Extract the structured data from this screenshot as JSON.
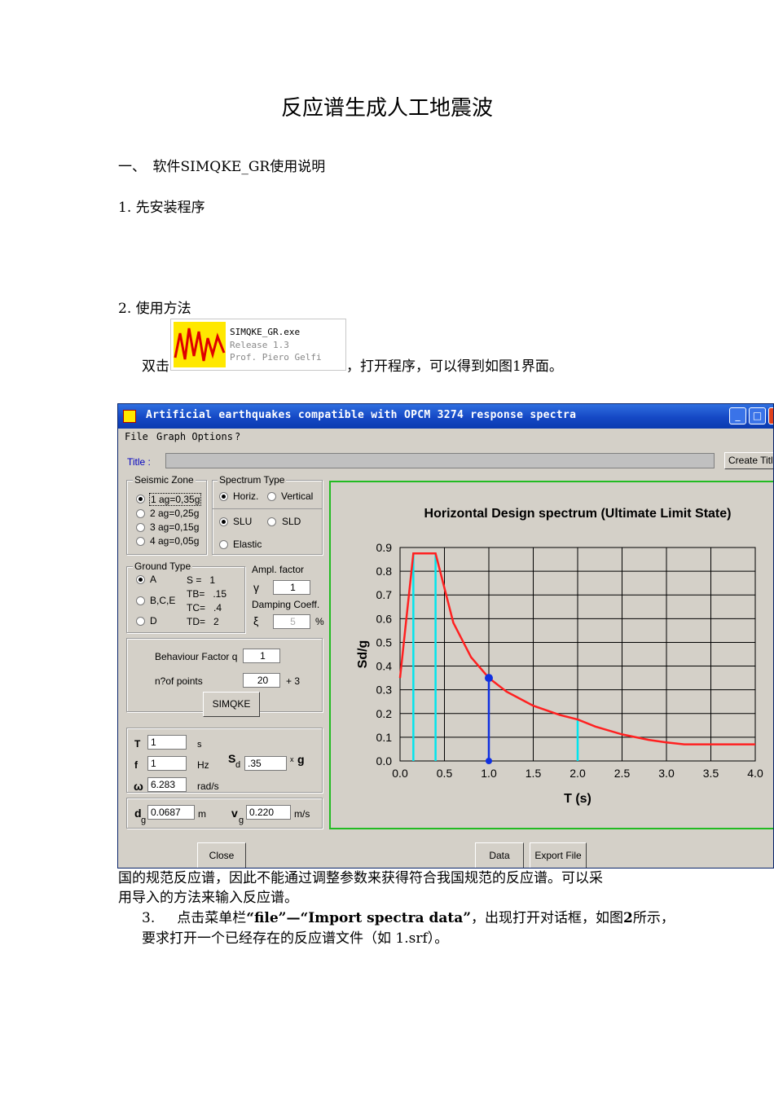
{
  "document": {
    "title": "反应谱生成人工地震波",
    "section1": "一、　软件SIMQKE_GR使用说明",
    "step1": "1. 先安装程序",
    "step2": "2. 使用方法",
    "dblclick": "双击",
    "after_icon": "，打开程序，可以得到如图1界面。",
    "exe_name": "SIMQKE_GR.exe",
    "exe_release": "Release 1.3",
    "exe_author": "Prof. Piero Gelfi",
    "para_line1": "国的规范反应谱，因此不能通过调整参数来获得符合我国规范的反应谱。可以采",
    "para_line2": "用导入的方法来输入反应谱。",
    "step3_num": "3.",
    "step3_a": "点击菜单栏",
    "step3_b": "“file”—“Import spectra data”",
    "step3_c": "，出现打开对话框，如图",
    "step3_d": "2",
    "step3_e": "所示，",
    "step3_line2": "要求打开一个已经存在的反应谱文件（如 1.srf）。"
  },
  "app": {
    "window_title": "Artificial earthquakes compatible with OPCM 3274 response spectra",
    "menu": [
      "File",
      "Graph Options",
      "?"
    ],
    "title_label": "Title :",
    "create_title_button": "Create Title",
    "seismic_zone": {
      "label": "Seismic Zone",
      "options": [
        "1 ag=0,35g",
        "2 ag=0,25g",
        "3 ag=0,15g",
        "4 ag=0,05g"
      ],
      "selected": 0
    },
    "spectrum_type": {
      "label": "Spectrum Type",
      "horiz": "Horiz.",
      "vertical": "Vertical",
      "slu": "SLU",
      "sld": "SLD",
      "elastic": "Elastic"
    },
    "ground_type": {
      "label": "Ground Type",
      "options": [
        "A",
        "B,C,E",
        "D"
      ],
      "s": "S =   1",
      "tb": "TB=   .15",
      "tc": "TC=   .4",
      "td": "TD=   2"
    },
    "ampl_factor_label": "Ampl. factor",
    "gamma": "γ",
    "ampl_factor_value": "1",
    "damping_label": "Damping Coeff.",
    "xi": "ξ",
    "damping_value": "5",
    "percent": "%",
    "behaviour_label": "Behaviour Factor q",
    "behaviour_value": "1",
    "npoints_label": "n?of points",
    "npoints_value": "20",
    "plus3": "+ 3",
    "simqke_button": "SIMQKE",
    "T_label": "T",
    "T_value": "1",
    "T_unit": "s",
    "f_label": "f",
    "f_value": "1",
    "f_unit": "Hz",
    "omega_label": "ω",
    "omega_value": "6.283",
    "omega_unit": "rad/s",
    "sd_label": "S",
    "sd_sub": "d",
    "sd_value": ".35",
    "sd_times": "x",
    "sd_g": "g",
    "dg_label": "d",
    "dg_sub": "g",
    "dg_value": "0.0687",
    "dg_unit": "m",
    "vg_label": "v",
    "vg_sub": "g",
    "vg_value": "0.220",
    "vg_unit": "m/s",
    "close_button": "Close",
    "data_button": "Data",
    "export_button": "Export File"
  },
  "chart_data": {
    "type": "line",
    "title": "Horizontal Design spectrum (Ultimate Limit State)",
    "xlabel": "T (s)",
    "ylabel": "Sd/g",
    "xlim": [
      0,
      4
    ],
    "ylim": [
      0,
      0.9
    ],
    "x_ticks": [
      "0.0",
      "0.5",
      "1.0",
      "1.5",
      "2.0",
      "2.5",
      "3.0",
      "3.5",
      "4.0"
    ],
    "y_ticks": [
      "0.0",
      "0.1",
      "0.2",
      "0.3",
      "0.4",
      "0.5",
      "0.6",
      "0.7",
      "0.8",
      "0.9"
    ],
    "grid": true,
    "series": [
      {
        "color": "#ff2020",
        "x": [
          0,
          0.15,
          0.4,
          0.6,
          0.8,
          1.0,
          1.2,
          1.5,
          1.8,
          2.0,
          2.2,
          2.5,
          2.8,
          3.0,
          3.2,
          3.5,
          4.0
        ],
        "y": [
          0.35,
          0.875,
          0.875,
          0.583,
          0.4375,
          0.35,
          0.292,
          0.233,
          0.194,
          0.175,
          0.145,
          0.112,
          0.089,
          0.078,
          0.07,
          0.07,
          0.07
        ]
      }
    ],
    "markers": [
      {
        "x": 1.0,
        "y": 0.35,
        "color": "#1030e0"
      }
    ],
    "vlines_cyan": [
      0.15,
      0.4,
      2.0
    ],
    "vline_blue": 1.0,
    "colors": {
      "curve": "#ff2020",
      "cyan": "#00e5ee",
      "blue": "#1030e0",
      "frame": "#22bb22"
    }
  }
}
